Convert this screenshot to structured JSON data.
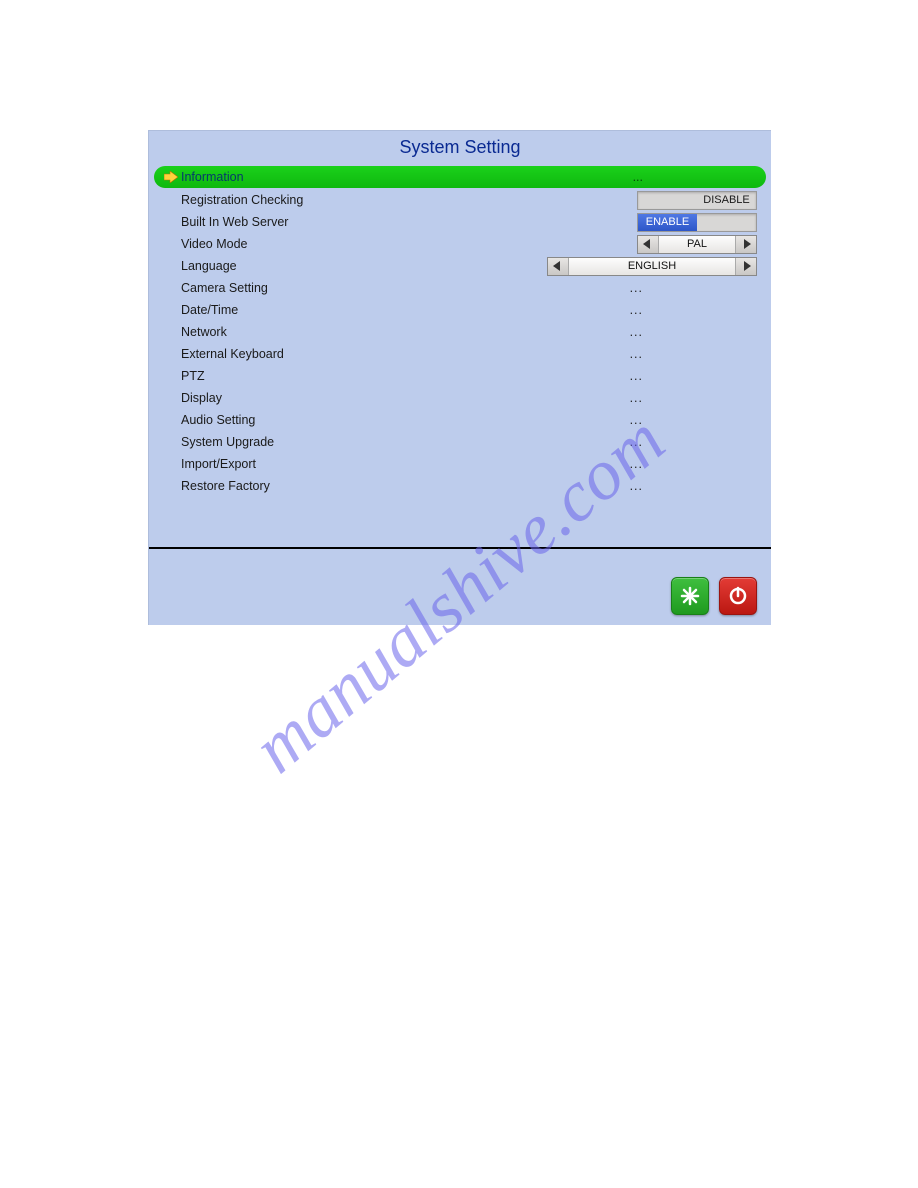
{
  "title": "System Setting",
  "watermark": "manualshive.com",
  "rows": {
    "information": {
      "label": "Information",
      "value": "..."
    },
    "registration": {
      "label": "Registration Checking",
      "toggle_left": "",
      "toggle_right": "DISABLE"
    },
    "webserver": {
      "label": "Built In Web Server",
      "toggle_left": "ENABLE",
      "toggle_right": ""
    },
    "videomode": {
      "label": "Video Mode",
      "value": "PAL"
    },
    "language": {
      "label": "Language",
      "value": "ENGLISH"
    },
    "camera": {
      "label": "Camera Setting",
      "value": "..."
    },
    "datetime": {
      "label": "Date/Time",
      "value": "..."
    },
    "network": {
      "label": "Network",
      "value": "..."
    },
    "keyboard": {
      "label": "External Keyboard",
      "value": "..."
    },
    "ptz": {
      "label": "PTZ",
      "value": "..."
    },
    "display": {
      "label": "Display",
      "value": "..."
    },
    "audio": {
      "label": "Audio Setting",
      "value": "..."
    },
    "upgrade": {
      "label": "System Upgrade",
      "value": "..."
    },
    "importexport": {
      "label": "Import/Export",
      "value": "..."
    },
    "restore": {
      "label": "Restore Factory",
      "value": "..."
    }
  }
}
